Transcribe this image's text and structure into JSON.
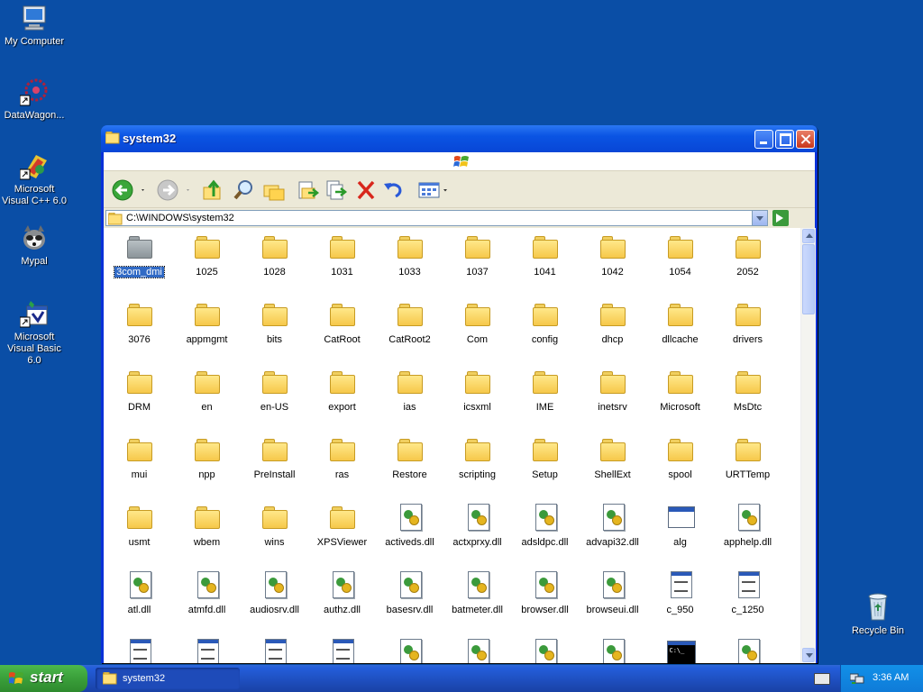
{
  "desktop": {
    "icons": [
      {
        "label": "My Computer",
        "icon": "my-computer-icon"
      },
      {
        "label": "DataWagon...",
        "icon": "datawagon-icon"
      },
      {
        "label": "Microsoft Visual C++ 6.0",
        "icon": "visual-cpp-icon"
      },
      {
        "label": "Mypal",
        "icon": "mypal-icon"
      },
      {
        "label": "Microsoft Visual Basic 6.0",
        "icon": "visual-basic-icon"
      }
    ],
    "recycle_bin": {
      "label": "Recycle Bin",
      "icon": "recycle-bin-icon"
    }
  },
  "window": {
    "title": "system32",
    "address": "C:\\WINDOWS\\system32",
    "files": [
      {
        "name": "3com_dmi",
        "type": "folder-grey",
        "selected": true
      },
      {
        "name": "1025",
        "type": "folder"
      },
      {
        "name": "1028",
        "type": "folder"
      },
      {
        "name": "1031",
        "type": "folder"
      },
      {
        "name": "1033",
        "type": "folder"
      },
      {
        "name": "1037",
        "type": "folder"
      },
      {
        "name": "1041",
        "type": "folder"
      },
      {
        "name": "1042",
        "type": "folder"
      },
      {
        "name": "1054",
        "type": "folder"
      },
      {
        "name": "2052",
        "type": "folder"
      },
      {
        "name": "3076",
        "type": "folder"
      },
      {
        "name": "appmgmt",
        "type": "folder"
      },
      {
        "name": "bits",
        "type": "folder"
      },
      {
        "name": "CatRoot",
        "type": "folder"
      },
      {
        "name": "CatRoot2",
        "type": "folder"
      },
      {
        "name": "Com",
        "type": "folder"
      },
      {
        "name": "config",
        "type": "folder"
      },
      {
        "name": "dhcp",
        "type": "folder"
      },
      {
        "name": "dllcache",
        "type": "folder"
      },
      {
        "name": "drivers",
        "type": "folder"
      },
      {
        "name": "DRM",
        "type": "folder"
      },
      {
        "name": "en",
        "type": "folder"
      },
      {
        "name": "en-US",
        "type": "folder"
      },
      {
        "name": "export",
        "type": "folder"
      },
      {
        "name": "ias",
        "type": "folder"
      },
      {
        "name": "icsxml",
        "type": "folder"
      },
      {
        "name": "IME",
        "type": "folder"
      },
      {
        "name": "inetsrv",
        "type": "folder"
      },
      {
        "name": "Microsoft",
        "type": "folder"
      },
      {
        "name": "MsDtc",
        "type": "folder"
      },
      {
        "name": "mui",
        "type": "folder"
      },
      {
        "name": "npp",
        "type": "folder"
      },
      {
        "name": "PreInstall",
        "type": "folder"
      },
      {
        "name": "ras",
        "type": "folder"
      },
      {
        "name": "Restore",
        "type": "folder"
      },
      {
        "name": "scripting",
        "type": "folder"
      },
      {
        "name": "Setup",
        "type": "folder"
      },
      {
        "name": "ShellExt",
        "type": "folder"
      },
      {
        "name": "spool",
        "type": "folder"
      },
      {
        "name": "URTTemp",
        "type": "folder"
      },
      {
        "name": "usmt",
        "type": "folder"
      },
      {
        "name": "wbem",
        "type": "folder"
      },
      {
        "name": "wins",
        "type": "folder"
      },
      {
        "name": "XPSViewer",
        "type": "folder"
      },
      {
        "name": "activeds.dll",
        "type": "dll"
      },
      {
        "name": "actxprxy.dll",
        "type": "dll"
      },
      {
        "name": "adsldpc.dll",
        "type": "dll"
      },
      {
        "name": "advapi32.dll",
        "type": "dll"
      },
      {
        "name": "alg",
        "type": "exe"
      },
      {
        "name": "apphelp.dll",
        "type": "dll"
      },
      {
        "name": "atl.dll",
        "type": "dll"
      },
      {
        "name": "atmfd.dll",
        "type": "dll"
      },
      {
        "name": "audiosrv.dll",
        "type": "dll"
      },
      {
        "name": "authz.dll",
        "type": "dll"
      },
      {
        "name": "basesrv.dll",
        "type": "dll"
      },
      {
        "name": "batmeter.dll",
        "type": "dll"
      },
      {
        "name": "browser.dll",
        "type": "dll"
      },
      {
        "name": "browseui.dll",
        "type": "dll"
      },
      {
        "name": "c_950",
        "type": "doc"
      },
      {
        "name": "c_1250",
        "type": "doc"
      },
      {
        "name": "",
        "type": "doc"
      },
      {
        "name": "",
        "type": "doc"
      },
      {
        "name": "",
        "type": "doc"
      },
      {
        "name": "",
        "type": "doc"
      },
      {
        "name": "",
        "type": "dll"
      },
      {
        "name": "",
        "type": "dll"
      },
      {
        "name": "",
        "type": "dll"
      },
      {
        "name": "",
        "type": "dll"
      },
      {
        "name": "",
        "type": "cmd"
      },
      {
        "name": "",
        "type": "dll"
      }
    ]
  },
  "taskbar": {
    "start_label": "start",
    "task_label": "system32",
    "clock": "3:36 AM"
  }
}
